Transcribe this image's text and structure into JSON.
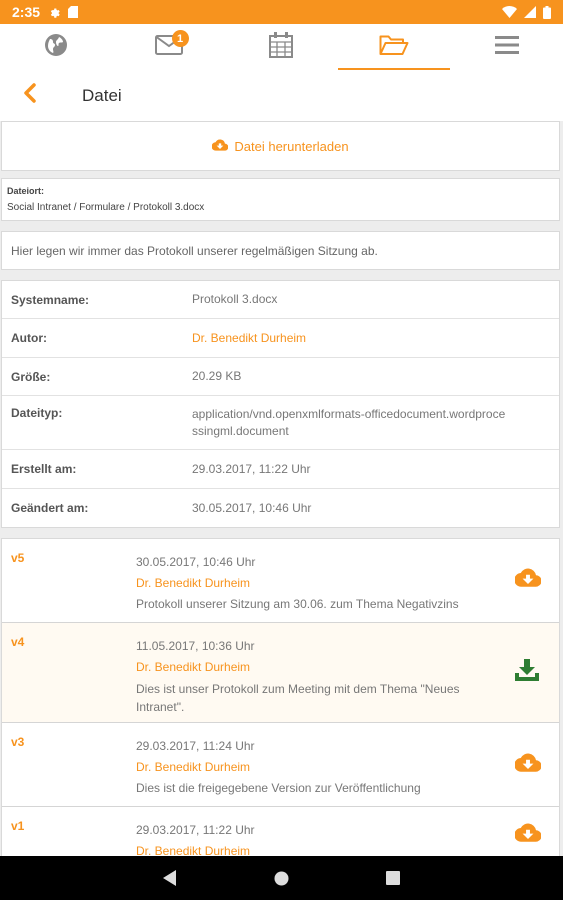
{
  "colors": {
    "accent": "#f7931e",
    "download_green": "#2e7d32"
  },
  "status_bar": {
    "time": "2:35",
    "left_icons": [
      "settings-icon",
      "sd-card-icon"
    ],
    "right_icons": [
      "wifi-icon",
      "signal-icon",
      "battery-icon"
    ]
  },
  "nav_tabs": [
    {
      "icon": "globe-icon",
      "active": false
    },
    {
      "icon": "mail-icon",
      "active": false,
      "badge": "1"
    },
    {
      "icon": "calendar-icon",
      "active": false
    },
    {
      "icon": "folder-open-icon",
      "active": true
    },
    {
      "icon": "menu-icon",
      "active": false
    }
  ],
  "header": {
    "back_icon": "chevron-left-icon",
    "title": "Datei"
  },
  "download": {
    "icon": "cloud-download-icon",
    "label": "Datei herunterladen"
  },
  "location": {
    "label": "Dateiort:",
    "path": "Social Intranet / Formulare / Protokoll 3.docx"
  },
  "description": "Hier legen wir immer das Protokoll unserer regelmäßigen Sitzung ab.",
  "properties": [
    {
      "label": "Systemname:",
      "value": "Protokoll 3.docx"
    },
    {
      "label": "Autor:",
      "value": "Dr. Benedikt Durheim",
      "link": true
    },
    {
      "label": "Größe:",
      "value": "20.29 KB"
    },
    {
      "label": "Dateityp:",
      "value_lines": [
        "application/vnd.openxmlformats-officedocument.wordproce",
        "ssingml.document"
      ]
    },
    {
      "label": "Erstellt am:",
      "value": "29.03.2017, 11:22 Uhr"
    },
    {
      "label": "Geändert am:",
      "value": "30.05.2017, 10:46 Uhr"
    }
  ],
  "versions": [
    {
      "version": "v5",
      "date": "30.05.2017, 10:46 Uhr",
      "author": "Dr. Benedikt Durheim",
      "comment_lines": [
        "Protokoll unserer Sitzung am 30.06. zum Thema Negativzins"
      ],
      "icon": "cloud-download-icon"
    },
    {
      "version": "v4",
      "date": "11.05.2017, 10:36 Uhr",
      "author": "Dr. Benedikt Durheim",
      "comment_lines": [
        "Dies ist unser Protokoll zum Meeting mit dem Thema \"Neues",
        "Intranet\"."
      ],
      "icon": "download-tray-icon",
      "current": true
    },
    {
      "version": "v3",
      "date": "29.03.2017, 11:24 Uhr",
      "author": "Dr. Benedikt Durheim",
      "comment_lines": [
        "Dies ist die freigegebene Version zur Veröffentlichung"
      ],
      "icon": "cloud-download-icon"
    },
    {
      "version": "v1",
      "date": "29.03.2017, 11:22 Uhr",
      "author": "Dr. Benedikt Durheim",
      "comment_lines": [],
      "icon": "cloud-download-icon"
    }
  ],
  "system_nav": [
    "back-triangle-icon",
    "home-circle-icon",
    "recents-square-icon"
  ]
}
